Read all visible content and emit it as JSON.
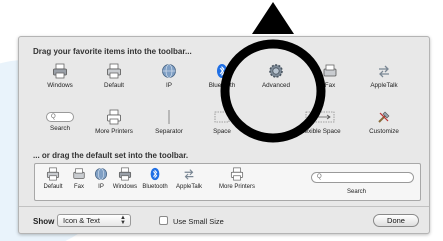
{
  "sheet": {
    "drag_items_label": "Drag your favorite items into the toolbar...",
    "drag_default_label": "... or drag the default set into the toolbar."
  },
  "items_row1": [
    {
      "label": "Windows",
      "icon": "printer-icon"
    },
    {
      "label": "Default",
      "icon": "printer-icon"
    },
    {
      "label": "IP",
      "icon": "globe-icon"
    },
    {
      "label": "Bluetooth",
      "icon": "bluetooth-icon"
    },
    {
      "label": "Advanced",
      "icon": "gear-icon"
    },
    {
      "label": "Fax",
      "icon": "fax-icon"
    },
    {
      "label": "AppleTalk",
      "icon": "appletalk-icon"
    }
  ],
  "items_row2": [
    {
      "label": "Search",
      "icon": "search-field-icon",
      "placeholder": "Q"
    },
    {
      "label": "More Printers",
      "icon": "printer-icon"
    },
    {
      "label": "Separator",
      "icon": "separator-icon"
    },
    {
      "label": "Space",
      "icon": "space-icon"
    },
    {
      "label": "Flexible Space",
      "icon": "flexible-space-icon"
    },
    {
      "label": "Customize",
      "icon": "customize-icon"
    }
  ],
  "default_set": [
    {
      "label": "Default",
      "icon": "printer-icon"
    },
    {
      "label": "Fax",
      "icon": "fax-icon"
    },
    {
      "label": "IP",
      "icon": "globe-icon"
    },
    {
      "label": "Windows",
      "icon": "printer-icon"
    },
    {
      "label": "Bluetooth",
      "icon": "bluetooth-icon"
    },
    {
      "label": "AppleTalk",
      "icon": "appletalk-icon"
    },
    {
      "label": "More Printers",
      "icon": "printer-icon"
    }
  ],
  "default_search": {
    "label": "Search",
    "placeholder": "Q"
  },
  "bottom": {
    "show_label": "Show",
    "show_value": "Icon & Text",
    "small_size_label": "Use Small Size",
    "small_size_checked": false,
    "done_label": "Done"
  },
  "colors": {
    "sheet_bg": "#e8e8e8",
    "annotation": "#000000",
    "bluetooth": "#1f6fe5"
  }
}
